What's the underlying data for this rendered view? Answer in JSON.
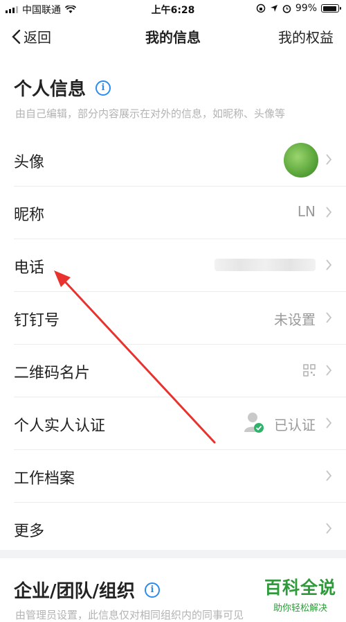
{
  "status_bar": {
    "carrier": "中国联通",
    "time": "上午6:28",
    "battery": "99%",
    "battery_level": 0.99
  },
  "nav": {
    "back_label": "返回",
    "title": "我的信息",
    "right_link": "我的权益"
  },
  "personal": {
    "title": "个人信息",
    "description": "由自己编辑，部分内容展示在对外的信息，如昵称、头像等",
    "rows": [
      {
        "label": "头像",
        "value": ""
      },
      {
        "label": "昵称",
        "value": "LN"
      },
      {
        "label": "电话",
        "value": ""
      },
      {
        "label": "钉钉号",
        "value": "未设置"
      },
      {
        "label": "二维码名片",
        "value": ""
      },
      {
        "label": "个人实人认证",
        "value": "已认证"
      },
      {
        "label": "工作档案",
        "value": ""
      },
      {
        "label": "更多",
        "value": ""
      }
    ]
  },
  "enterprise": {
    "title": "企业/团队/组织",
    "description": "由管理员设置，此信息仅对相同组织内的同事可见"
  },
  "watermark": {
    "title": "百科全说",
    "subtitle": "助你轻松解决"
  },
  "colors": {
    "accent": "#2a8bf2",
    "arrow": "#e8322e",
    "watermark": "#2e9a3a"
  }
}
